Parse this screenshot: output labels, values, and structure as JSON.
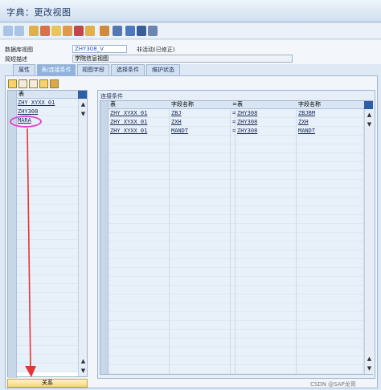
{
  "window": {
    "title": "字典：更改视图"
  },
  "toolbar": {
    "icons": [
      "back-arrow-icon",
      "forward-arrow-icon",
      "tools-icon",
      "object-icon",
      "display-icon",
      "copy-icon",
      "pen-icon",
      "where-used-icon",
      "hierarchy-icon",
      "layout-icon",
      "info-icon",
      "grid-icon"
    ]
  },
  "fields": {
    "view_label": "数据库视图",
    "view_value": "ZHY308_V",
    "status": "非活动(已修正)",
    "desc_label": "简短描述",
    "desc_value": "学院信息视图"
  },
  "tabs": [
    {
      "label": "属性"
    },
    {
      "label": "表/连接条件"
    },
    {
      "label": "视图字段"
    },
    {
      "label": "选择条件"
    },
    {
      "label": "维护状态"
    }
  ],
  "tables": {
    "header": "表",
    "rows": [
      "ZHY_XYXX_01",
      "ZHY308",
      "MARA",
      "",
      "",
      "",
      "",
      "",
      "",
      "",
      "",
      "",
      "",
      "",
      "",
      "",
      "",
      "",
      "",
      "",
      "",
      "",
      "",
      "",
      "",
      "",
      "",
      "",
      "",
      "",
      ""
    ],
    "relation_button": "关系"
  },
  "join": {
    "title": "连接条件",
    "headers": [
      "表",
      "字段名称",
      "=",
      "表",
      "字段名称"
    ],
    "rows": [
      [
        "ZHY_XYXX_01",
        "ZBJ",
        "=",
        "ZHY308",
        "ZBJBM"
      ],
      [
        "ZHY_XYXX_01",
        "ZXH",
        "=",
        "ZHY308",
        "ZXH"
      ],
      [
        "ZHY_XYXX_01",
        "MANDT",
        "=",
        "ZHY308",
        "MANDT"
      ],
      [
        "",
        "",
        "",
        "",
        ""
      ],
      [
        "",
        "",
        "",
        "",
        ""
      ],
      [
        "",
        "",
        "",
        "",
        ""
      ],
      [
        "",
        "",
        "",
        "",
        ""
      ],
      [
        "",
        "",
        "",
        "",
        ""
      ],
      [
        "",
        "",
        "",
        "",
        ""
      ],
      [
        "",
        "",
        "",
        "",
        ""
      ],
      [
        "",
        "",
        "",
        "",
        ""
      ],
      [
        "",
        "",
        "",
        "",
        ""
      ],
      [
        "",
        "",
        "",
        "",
        ""
      ],
      [
        "",
        "",
        "",
        "",
        ""
      ],
      [
        "",
        "",
        "",
        "",
        ""
      ],
      [
        "",
        "",
        "",
        "",
        ""
      ],
      [
        "",
        "",
        "",
        "",
        ""
      ],
      [
        "",
        "",
        "",
        "",
        ""
      ],
      [
        "",
        "",
        "",
        "",
        ""
      ],
      [
        "",
        "",
        "",
        "",
        ""
      ],
      [
        "",
        "",
        "",
        "",
        ""
      ],
      [
        "",
        "",
        "",
        "",
        ""
      ],
      [
        "",
        "",
        "",
        "",
        ""
      ],
      [
        "",
        "",
        "",
        "",
        ""
      ],
      [
        "",
        "",
        "",
        "",
        ""
      ],
      [
        "",
        "",
        "",
        "",
        ""
      ],
      [
        "",
        "",
        "",
        "",
        ""
      ],
      [
        "",
        "",
        "",
        "",
        ""
      ],
      [
        "",
        "",
        "",
        "",
        ""
      ],
      [
        "",
        "",
        "",
        "",
        ""
      ]
    ]
  },
  "watermark": "CSDN @SAP龙哥",
  "colors": {
    "accent": "#2e5fa5",
    "highlight_ellipse": "#e044c8",
    "arrow": "#e53535"
  }
}
